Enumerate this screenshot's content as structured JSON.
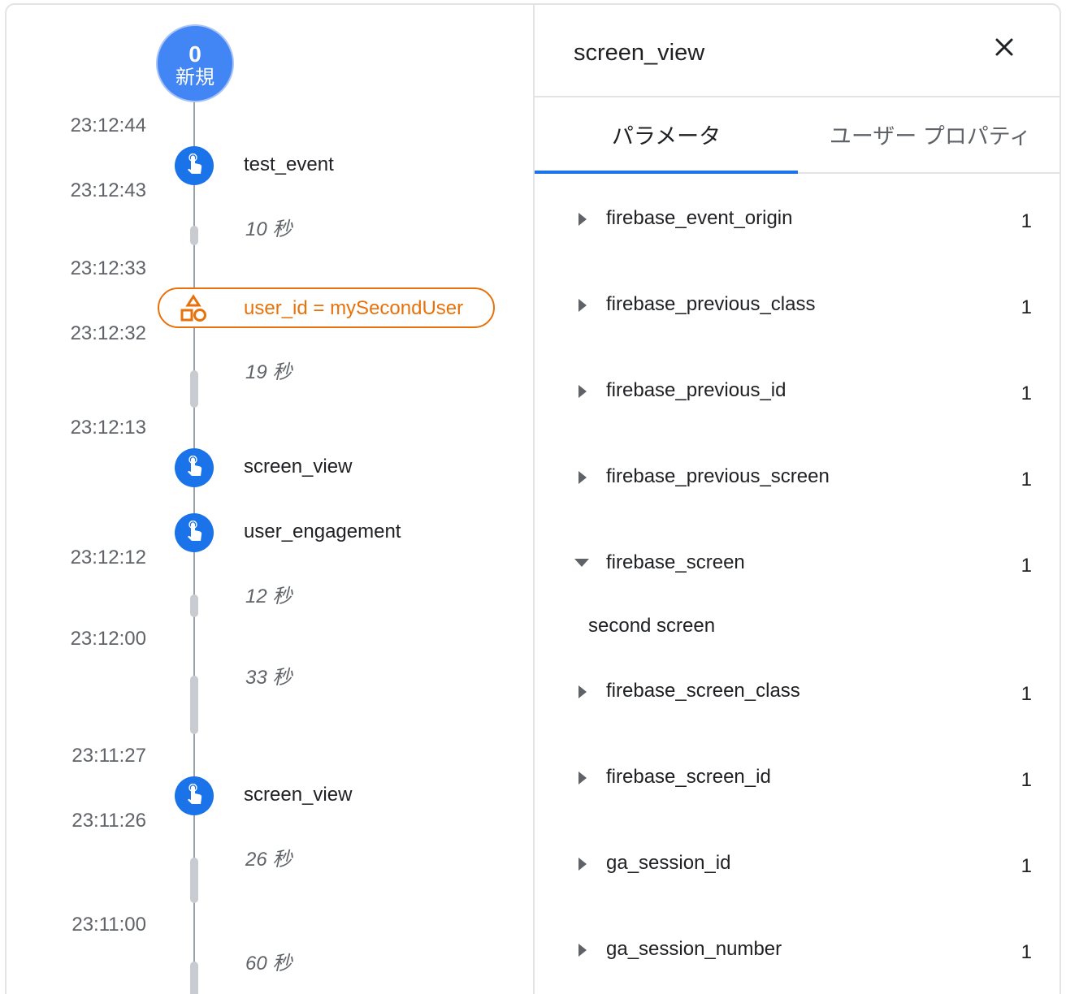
{
  "timeline": {
    "new_badge": {
      "count": "0",
      "label": "新規"
    },
    "timestamps": [
      "23:12:44",
      "23:12:43",
      "23:12:33",
      "23:12:32",
      "23:12:13",
      "23:12:12",
      "23:12:00",
      "23:11:27",
      "23:11:26",
      "23:11:00"
    ],
    "events": [
      "test_event",
      "screen_view",
      "user_engagement",
      "screen_view"
    ],
    "gaps": [
      "10 秒",
      "19 秒",
      "12 秒",
      "33 秒",
      "26 秒",
      "60 秒"
    ],
    "user_property": "user_id = mySecondUser"
  },
  "panel": {
    "title": "screen_view",
    "tabs": [
      "パラメータ",
      "ユーザー プロパティ"
    ],
    "params": [
      {
        "name": "firebase_event_origin",
        "count": "1"
      },
      {
        "name": "firebase_previous_class",
        "count": "1"
      },
      {
        "name": "firebase_previous_id",
        "count": "1"
      },
      {
        "name": "firebase_previous_screen",
        "count": "1"
      },
      {
        "name": "firebase_screen",
        "count": "1",
        "expanded_value": "second screen"
      },
      {
        "name": "firebase_screen_class",
        "count": "1"
      },
      {
        "name": "firebase_screen_id",
        "count": "1"
      },
      {
        "name": "ga_session_id",
        "count": "1"
      },
      {
        "name": "ga_session_number",
        "count": "1"
      }
    ]
  },
  "colors": {
    "accent_blue": "#1a73e8",
    "badge_blue": "#4285f4",
    "property_orange": "#e8710a"
  },
  "icons": {
    "event": "touch-icon",
    "property": "shapes-icon",
    "close": "close-icon",
    "caret_collapsed": "caret-right-icon",
    "caret_expanded": "caret-down-icon"
  }
}
